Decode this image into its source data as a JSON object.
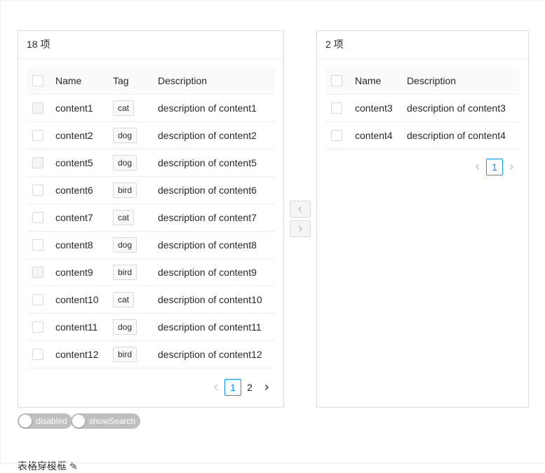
{
  "left_panel": {
    "count_label": "18 项",
    "columns": [
      "Name",
      "Tag",
      "Description"
    ],
    "rows": [
      {
        "name": "content1",
        "tag": "cat",
        "desc": "description of content1",
        "disabled": true
      },
      {
        "name": "content2",
        "tag": "dog",
        "desc": "description of content2",
        "disabled": false
      },
      {
        "name": "content5",
        "tag": "dog",
        "desc": "description of content5",
        "disabled": true
      },
      {
        "name": "content6",
        "tag": "bird",
        "desc": "description of content6",
        "disabled": false
      },
      {
        "name": "content7",
        "tag": "cat",
        "desc": "description of content7",
        "disabled": false
      },
      {
        "name": "content8",
        "tag": "dog",
        "desc": "description of content8",
        "disabled": false
      },
      {
        "name": "content9",
        "tag": "bird",
        "desc": "description of content9",
        "disabled": true
      },
      {
        "name": "content10",
        "tag": "cat",
        "desc": "description of content10",
        "disabled": false
      },
      {
        "name": "content11",
        "tag": "dog",
        "desc": "description of content11",
        "disabled": false
      },
      {
        "name": "content12",
        "tag": "bird",
        "desc": "description of content12",
        "disabled": false
      }
    ],
    "pagination": {
      "pages": [
        "1",
        "2"
      ],
      "current": "1"
    }
  },
  "right_panel": {
    "count_label": "2 项",
    "columns": [
      "Name",
      "Description"
    ],
    "rows": [
      {
        "name": "content3",
        "desc": "description of content3"
      },
      {
        "name": "content4",
        "desc": "description of content4"
      }
    ],
    "pagination": {
      "pages": [
        "1"
      ],
      "current": "1"
    }
  },
  "operations": {
    "left_icon": "chevron-left-icon",
    "right_icon": "chevron-right-icon"
  },
  "switches": [
    {
      "label": "disabled",
      "checked": false
    },
    {
      "label": "showSearch",
      "checked": false
    }
  ],
  "section_title": "表格穿梭框 ✎",
  "colors": {
    "accent": "#1890ff",
    "border": "#d9d9d9",
    "switch_off": "#bfbfbf"
  }
}
